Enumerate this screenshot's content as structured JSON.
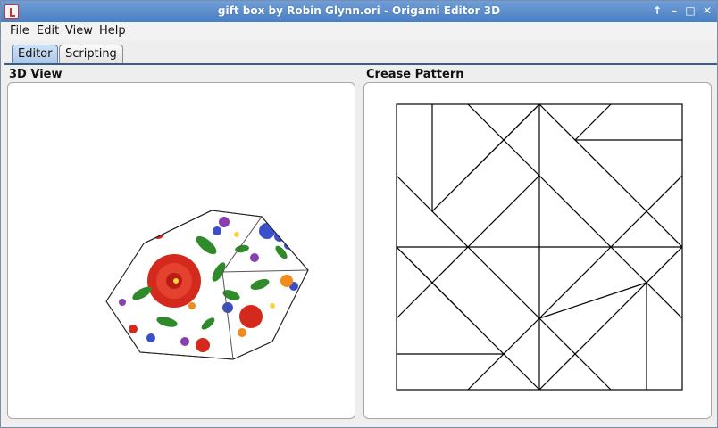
{
  "window": {
    "title": "gift box by Robin Glynn.ori - Origami Editor 3D",
    "controls": [
      "↑",
      "–",
      "□",
      "✕"
    ]
  },
  "menu": {
    "items": [
      "File",
      "Edit",
      "View",
      "Help"
    ]
  },
  "tabs": [
    {
      "label": "Editor",
      "selected": true
    },
    {
      "label": "Scripting",
      "selected": false
    }
  ],
  "panels": {
    "view3d": {
      "label": "3D View"
    },
    "crease": {
      "label": "Crease Pattern"
    }
  },
  "colors": {
    "accent": "#4a7fc2",
    "tab_selected": "#a9c6e8",
    "flower_red": "#d42a1e",
    "leaf_green": "#2f8a2a",
    "flower_blue": "#3a4fc9",
    "flower_orange": "#f08a1a",
    "flower_purple": "#8a3fb0"
  }
}
